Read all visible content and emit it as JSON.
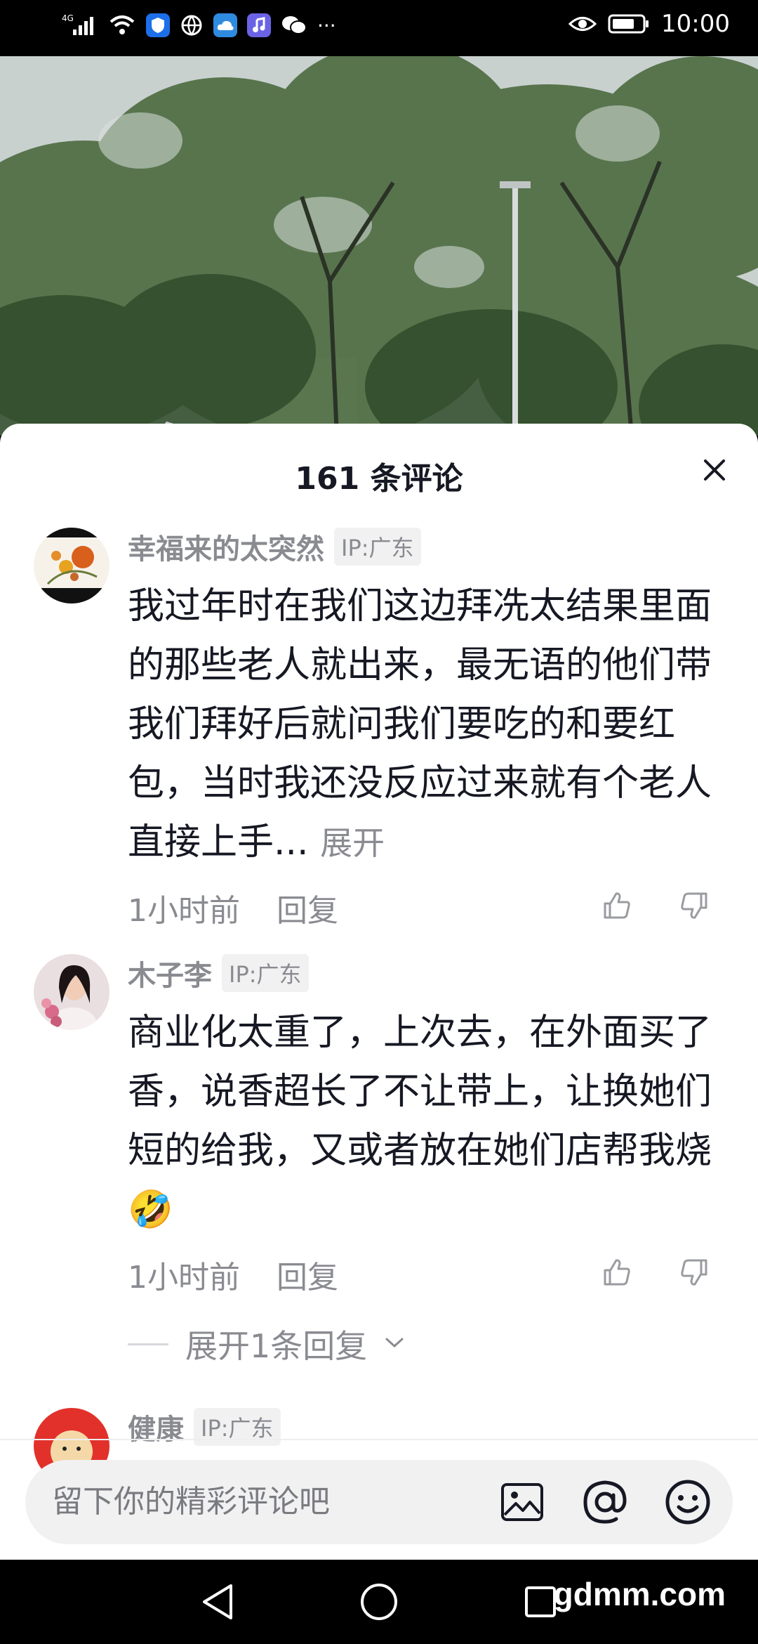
{
  "status_bar": {
    "network": "4G",
    "time": "10:00",
    "more": "···"
  },
  "sheet": {
    "title": "161 条评论"
  },
  "comments": [
    {
      "username": "幸福来的太突然",
      "ip": "IP:广东",
      "text": "我过年时在我们这边拜冼太结果里面的那些老人就出来，最无语的他们带我们拜好后就问我们要吃的和要红包，当时我还没反应过来就有个老人直接上手...",
      "expand": "展开",
      "time": "1小时前",
      "reply": "回复"
    },
    {
      "username": "木子李",
      "ip": "IP:广东",
      "text": "商业化太重了，上次去，在外面买了香，说香超长了不让带上，让换她们短的给我，又或者放在她们店帮我烧🤣",
      "time": "1小时前",
      "reply": "回复",
      "more_replies": "展开1条回复"
    },
    {
      "username": "健康",
      "ip": "IP:广东"
    }
  ],
  "input": {
    "placeholder": "留下你的精彩评论吧"
  },
  "watermark": "gdmm.com",
  "icons": {
    "close": "close-icon",
    "like": "thumbs-up-icon",
    "dislike": "thumbs-down-icon",
    "image": "image-icon",
    "mention": "at-icon",
    "emoji": "emoji-icon"
  }
}
